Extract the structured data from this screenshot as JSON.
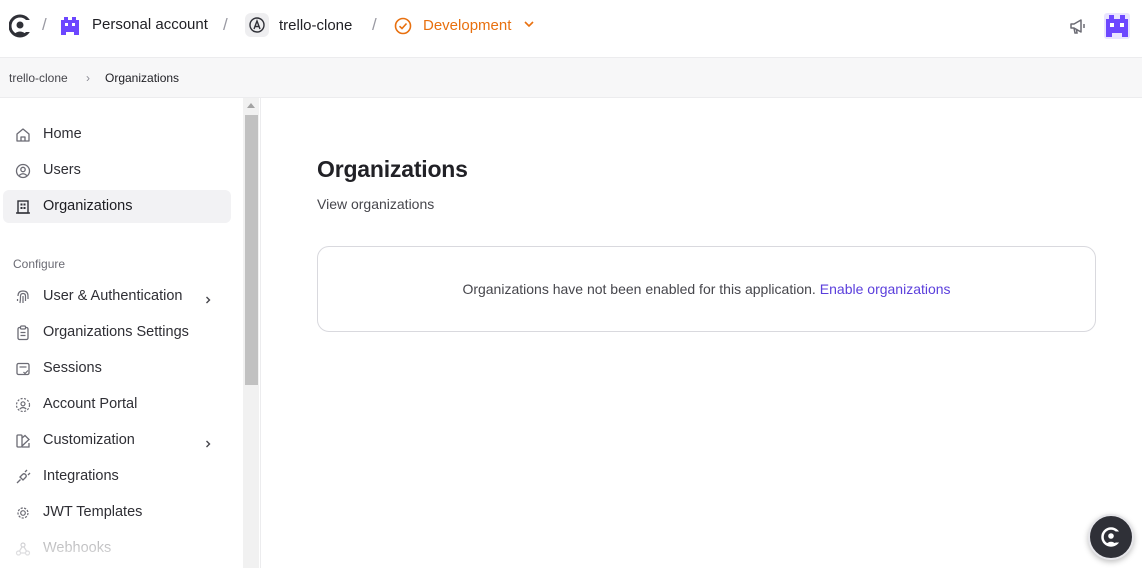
{
  "topbar": {
    "workspace_label": "Personal account",
    "app_label": "trello-clone",
    "environment_label": "Development",
    "separator": "/",
    "colors": {
      "environment": "#e8700f",
      "avatar": "#6c47ff"
    }
  },
  "breadcrumb": {
    "items": [
      "trello-clone",
      "Organizations"
    ],
    "separator": "›"
  },
  "sidebar": {
    "items": [
      {
        "label": "Home",
        "icon": "home-icon"
      },
      {
        "label": "Users",
        "icon": "user-circle-icon"
      },
      {
        "label": "Organizations",
        "icon": "building-icon",
        "active": true
      }
    ],
    "section_label": "Configure",
    "config_items": [
      {
        "label": "User & Authentication",
        "icon": "fingerprint-icon",
        "expandable": true
      },
      {
        "label": "Organizations Settings",
        "icon": "clipboard-icon"
      },
      {
        "label": "Sessions",
        "icon": "session-icon"
      },
      {
        "label": "Account Portal",
        "icon": "portal-icon"
      },
      {
        "label": "Customization",
        "icon": "palette-icon",
        "expandable": true
      },
      {
        "label": "Integrations",
        "icon": "plug-icon"
      },
      {
        "label": "JWT Templates",
        "icon": "gear-icon"
      },
      {
        "label": "Webhooks",
        "icon": "webhook-icon"
      }
    ]
  },
  "main": {
    "title": "Organizations",
    "subtitle": "View organizations",
    "notice_text": "Organizations have not been enabled for this application.",
    "notice_link": "Enable organizations",
    "colors": {
      "link": "#5b3fdc"
    }
  }
}
